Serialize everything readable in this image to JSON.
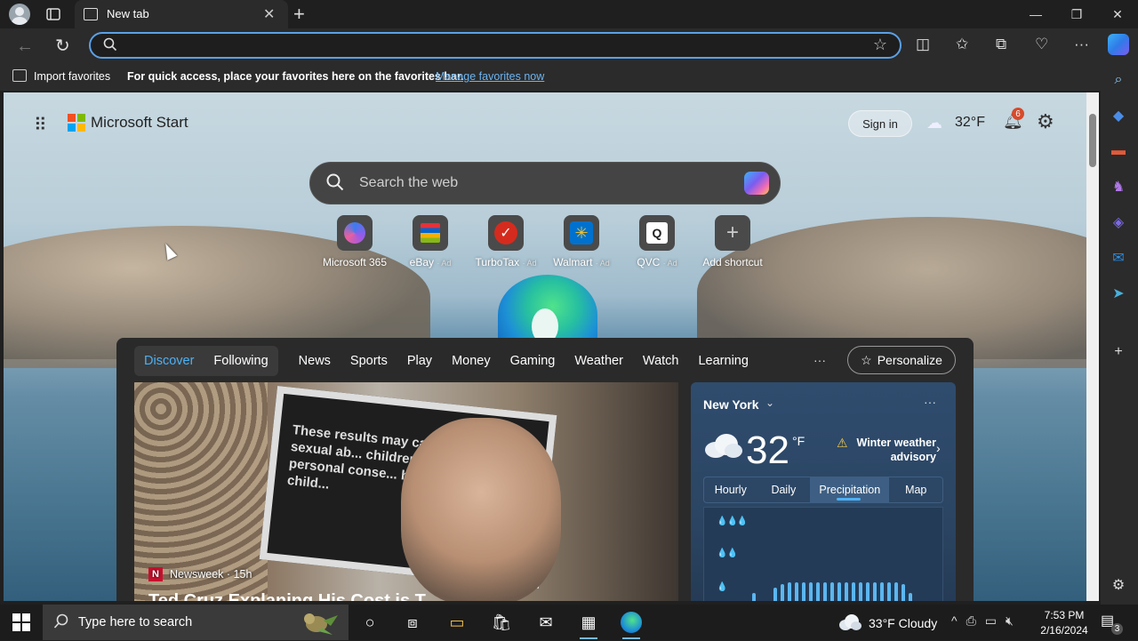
{
  "browser": {
    "tab_title": "New tab",
    "omnibox_value": "",
    "favbar": {
      "import_label": "Import favorites",
      "message": "For quick access, place your favorites here on the favorites bar.",
      "link": "Manage favorites now"
    }
  },
  "page": {
    "brand": "Microsoft Start",
    "signin": "Sign in",
    "header_temp": "32°F",
    "notification_count": "6",
    "search_placeholder": "Search the web",
    "shortcuts": [
      {
        "label": "Microsoft 365",
        "ad": ""
      },
      {
        "label": "eBay",
        "ad": "· Ad"
      },
      {
        "label": "TurboTax",
        "ad": "· Ad"
      },
      {
        "label": "Walmart",
        "ad": "· Ad"
      },
      {
        "label": "QVC",
        "ad": "· Ad"
      },
      {
        "label": "Add shortcut",
        "ad": ""
      }
    ],
    "feed": {
      "pill_tabs": [
        "Discover",
        "Following"
      ],
      "nav": [
        "News",
        "Sports",
        "Play",
        "Money",
        "Gaming",
        "Weather",
        "Watch",
        "Learning"
      ],
      "more": "···",
      "personalize": "Personalize",
      "hero": {
        "sign_text": "These results may ca... Child sexual ab... children can lea... personal conse... harm to child...",
        "source": "Newsweek · 15h",
        "source_badge": "N",
        "headline": "Ted Cruz Explaning His Cost is T..."
      }
    },
    "weather": {
      "location": "New York",
      "temp": "32",
      "unit": "°F",
      "alert": "Winter weather advisory",
      "tabs": [
        "Hourly",
        "Daily",
        "Precipitation",
        "Map"
      ],
      "active_tab": "Precipitation",
      "chart_drops": [
        "💧💧💧",
        "💧💧",
        "💧"
      ]
    }
  },
  "taskbar": {
    "search_placeholder": "Type here to search",
    "weather": "33°F  Cloudy",
    "time": "7:53 PM",
    "date": "2/16/2024",
    "notification_count": "3"
  },
  "colors": {
    "accent": "#4cb0f5",
    "link": "#6cb4f0",
    "omnibox_border": "#5ba0e6"
  }
}
